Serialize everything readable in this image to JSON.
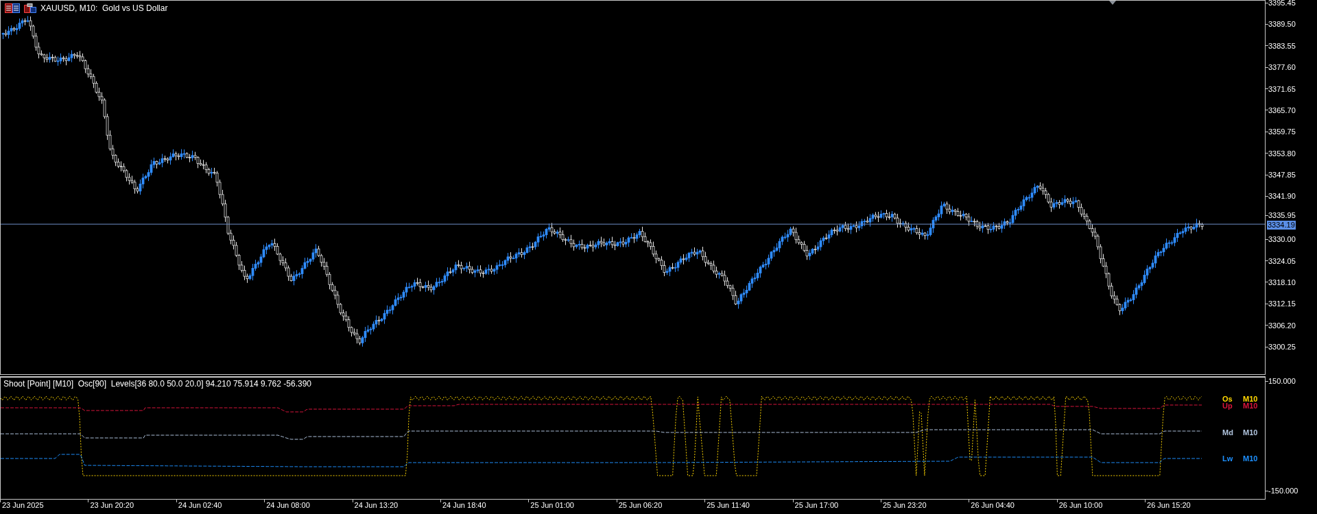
{
  "chart": {
    "title": "XAUUSD, M10:  Gold vs US Dollar",
    "price_axis": [
      "3395.45",
      "3389.50",
      "3383.55",
      "3377.60",
      "3371.65",
      "3365.70",
      "3359.75",
      "3353.80",
      "3347.85",
      "3341.90",
      "3335.95",
      "3330.00",
      "3324.05",
      "3318.10",
      "3312.15",
      "3306.20",
      "3300.25"
    ],
    "current_price": "3334.19"
  },
  "indicator": {
    "title": "Shoot [Point] [M10]  Osc[90]  Levels[36 80.0 50.0 20.0] 94.210 75.914 9.762 -56.390",
    "axis": [
      "150.000",
      "-150.000"
    ],
    "legend": [
      {
        "name": "Os",
        "timeframe": "M10",
        "color": "#ffd700"
      },
      {
        "name": "Up",
        "timeframe": "M10",
        "color": "#dc143c"
      },
      {
        "name": "Md",
        "timeframe": "M10",
        "color": "#b0c4de"
      },
      {
        "name": "Lw",
        "timeframe": "M10",
        "color": "#1e90ff"
      }
    ]
  },
  "time_axis": [
    "23 Jun 2025",
    "23 Jun 20:20",
    "24 Jun 02:40",
    "24 Jun 08:00",
    "24 Jun 13:20",
    "24 Jun 18:40",
    "25 Jun 01:00",
    "25 Jun 06:20",
    "25 Jun 11:40",
    "25 Jun 17:00",
    "25 Jun 23:20",
    "26 Jun 04:40",
    "26 Jun 10:00",
    "26 Jun 15:20"
  ]
}
